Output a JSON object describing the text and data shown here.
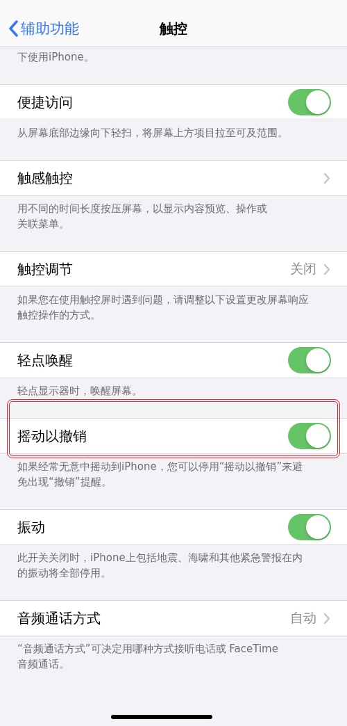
{
  "nav": {
    "back": "辅助功能",
    "title": "触控"
  },
  "top_footer": [
    "下使用iPhone。"
  ],
  "sections": [
    {
      "label": "便捷访问",
      "kind": "toggle",
      "on": true,
      "highlighted": false,
      "footer": [
        "从屏幕底部边缘向下轻扫，将屏幕上方项目拉至可及范围。"
      ]
    },
    {
      "label": "触感触控",
      "kind": "link",
      "highlighted": false,
      "footer": [
        "用不同的时间长度按压屏幕，以显示内容预览、操作或",
        "关联菜单。"
      ]
    },
    {
      "label": "触控调节",
      "kind": "link",
      "value": "关闭",
      "highlighted": false,
      "footer": [
        "如果您在使用触控屏时遇到问题，请调整以下设置更改屏幕响应",
        "触控操作的方式。"
      ]
    },
    {
      "label": "轻点唤醒",
      "kind": "toggle",
      "on": true,
      "highlighted": false,
      "footer": [
        "轻点显示器时，唤醒屏幕。"
      ]
    },
    {
      "label": "摇动以撤销",
      "kind": "toggle",
      "on": true,
      "highlighted": true,
      "footer": [
        "如果经常无意中摇动到iPhone，您可以停用“摇动以撤销”来避",
        "免出现“撤销”提醒。"
      ]
    },
    {
      "label": "振动",
      "kind": "toggle",
      "on": true,
      "highlighted": false,
      "footer": [
        "此开关关闭时，iPhone上包括地震、海啸和其他紧急警报在内",
        "的振动将全部停用。"
      ]
    },
    {
      "label": "音频通话方式",
      "kind": "link",
      "value": "自动",
      "highlighted": false,
      "footer": [
        "“音频通话方式”可决定用哪种方式接听电话或 FaceTime",
        "音频通话。"
      ]
    }
  ]
}
